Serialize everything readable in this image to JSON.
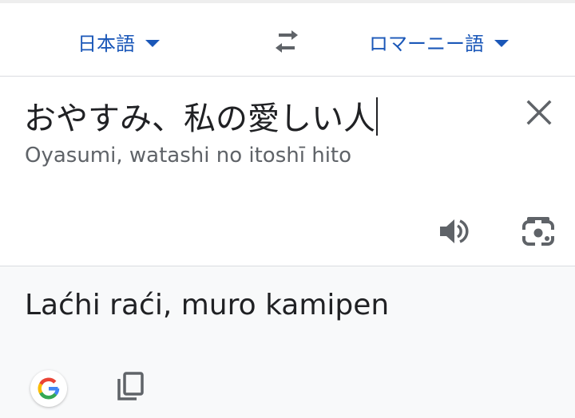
{
  "colors": {
    "accent": "#1a57b8",
    "text_primary": "#202124",
    "text_secondary": "#5f6368",
    "icon": "#5f6368",
    "output_bg": "#f8f9fa"
  },
  "language_bar": {
    "source_language": "日本語",
    "target_language": "ロマーニー語",
    "dropdown_icon": "caret-down-icon",
    "swap_icon": "swap-arrows-icon"
  },
  "input": {
    "source_text": "おやすみ、私の愛しい人",
    "transliteration": "Oyasumi, watashi no itoshī hito",
    "clear_icon": "close-icon",
    "speaker_icon": "speaker-icon",
    "camera_icon": "camera-icon"
  },
  "output": {
    "translation": "Laćhi raći, muro kamipen",
    "google_icon": "google-logo-icon",
    "copy_icon": "copy-icon"
  }
}
